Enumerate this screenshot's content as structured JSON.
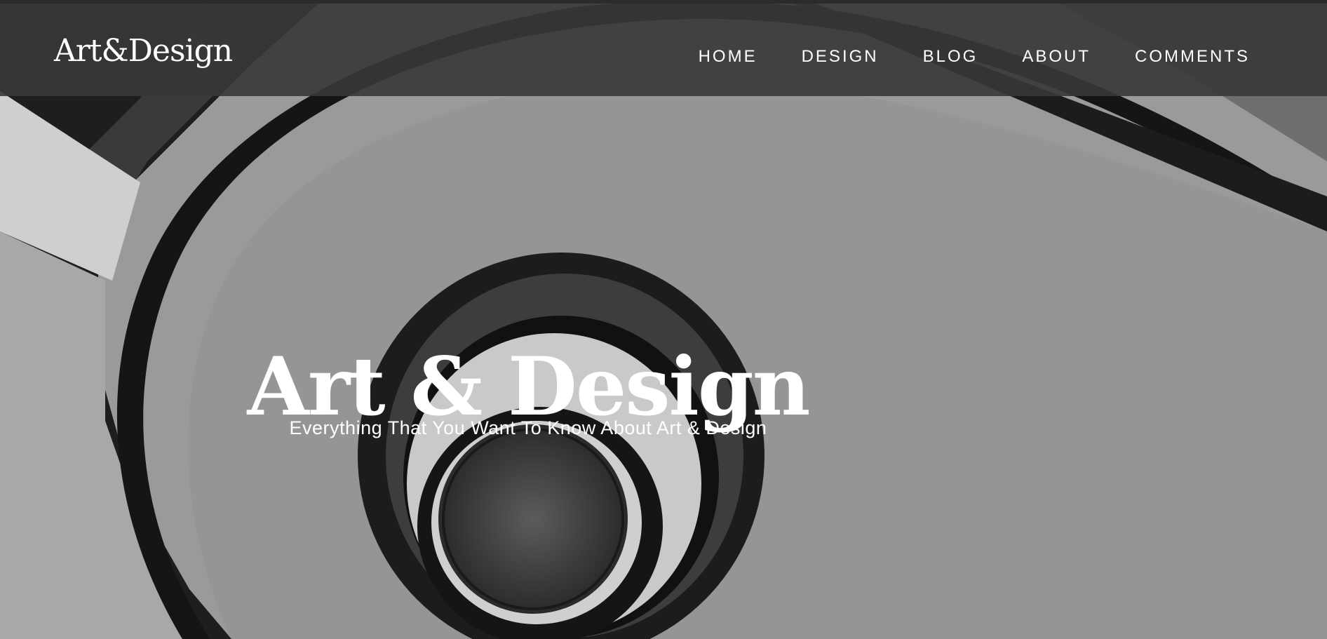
{
  "site": {
    "brand": "Art&Design"
  },
  "nav": {
    "items": [
      {
        "label": "HOME"
      },
      {
        "label": "DESIGN"
      },
      {
        "label": "BLOG"
      },
      {
        "label": "ABOUT"
      },
      {
        "label": "COMMENTS"
      }
    ]
  },
  "hero": {
    "title": "Art & Design",
    "subtitle": "Everything That You Want To Know About Art & Design"
  },
  "colors": {
    "navbar_bg": "#373737",
    "text": "#ffffff",
    "background": "#8a8a8a"
  },
  "icons": {
    "background": "spiral-staircase-photo"
  }
}
